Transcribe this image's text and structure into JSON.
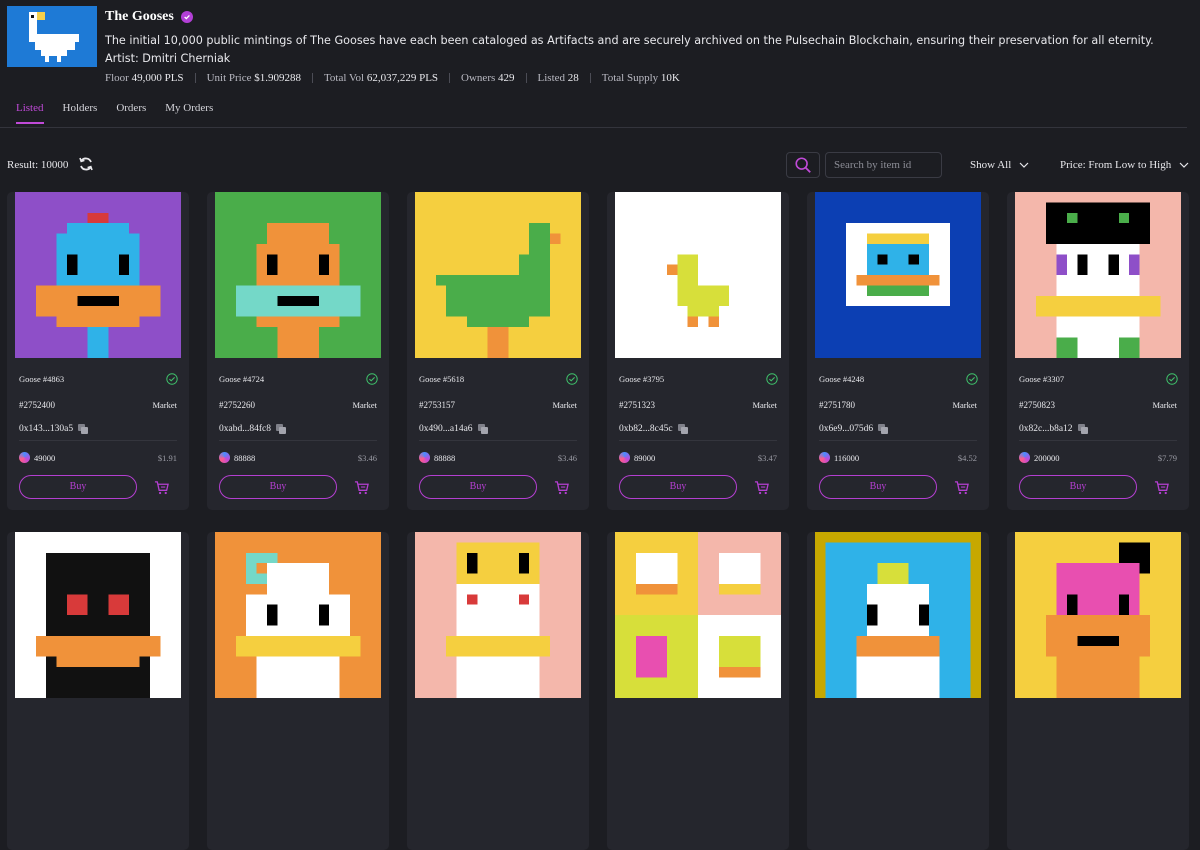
{
  "collection": {
    "title": "The Gooses",
    "description": "The initial 10,000 public mintings of The Gooses have each been cataloged as Artifacts and are securely archived on the Pulsechain Blockchain, ensuring their preservation for all eternity. Artist: Dmitri Cherniak",
    "stats": [
      {
        "label": "Floor",
        "value": "49,000 PLS"
      },
      {
        "label": "Unit Price",
        "value": "$1.909288"
      },
      {
        "label": "Total Vol",
        "value": "62,037,229 PLS"
      },
      {
        "label": "Owners",
        "value": "429"
      },
      {
        "label": "Listed",
        "value": "28"
      },
      {
        "label": "Total Supply",
        "value": "10K"
      }
    ]
  },
  "tabs": [
    "Listed",
    "Holders",
    "Orders",
    "My Orders"
  ],
  "toolbar": {
    "result": "Result: 10000",
    "search_placeholder": "Search by item id",
    "filter": "Show All",
    "sort": "Price: From Low to High"
  },
  "colors": {
    "accent": "#c04ad8",
    "background": "#1c1d22",
    "card": "#25262d",
    "verified": "#b23fd6",
    "check": "#3fbf6a"
  },
  "cards": [
    {
      "name": "Goose #4863",
      "token": "#2752400",
      "market": "Market",
      "address": "0x143...130a5",
      "price": "49000",
      "usd": "$1.91",
      "buy": "Buy"
    },
    {
      "name": "Goose #4724",
      "token": "#2752260",
      "market": "Market",
      "address": "0xabd...84fc8",
      "price": "88888",
      "usd": "$3.46",
      "buy": "Buy"
    },
    {
      "name": "Goose #5618",
      "token": "#2753157",
      "market": "Market",
      "address": "0x490...a14a6",
      "price": "88888",
      "usd": "$3.46",
      "buy": "Buy"
    },
    {
      "name": "Goose #3795",
      "token": "#2751323",
      "market": "Market",
      "address": "0xb82...8c45c",
      "price": "89000",
      "usd": "$3.47",
      "buy": "Buy"
    },
    {
      "name": "Goose #4248",
      "token": "#2751780",
      "market": "Market",
      "address": "0x6e9...075d6",
      "price": "116000",
      "usd": "$4.52",
      "buy": "Buy"
    },
    {
      "name": "Goose #3307",
      "token": "#2750823",
      "market": "Market",
      "address": "0x82c...b8a12",
      "price": "200000",
      "usd": "$7.79",
      "buy": "Buy"
    },
    {},
    {},
    {},
    {},
    {},
    {}
  ]
}
